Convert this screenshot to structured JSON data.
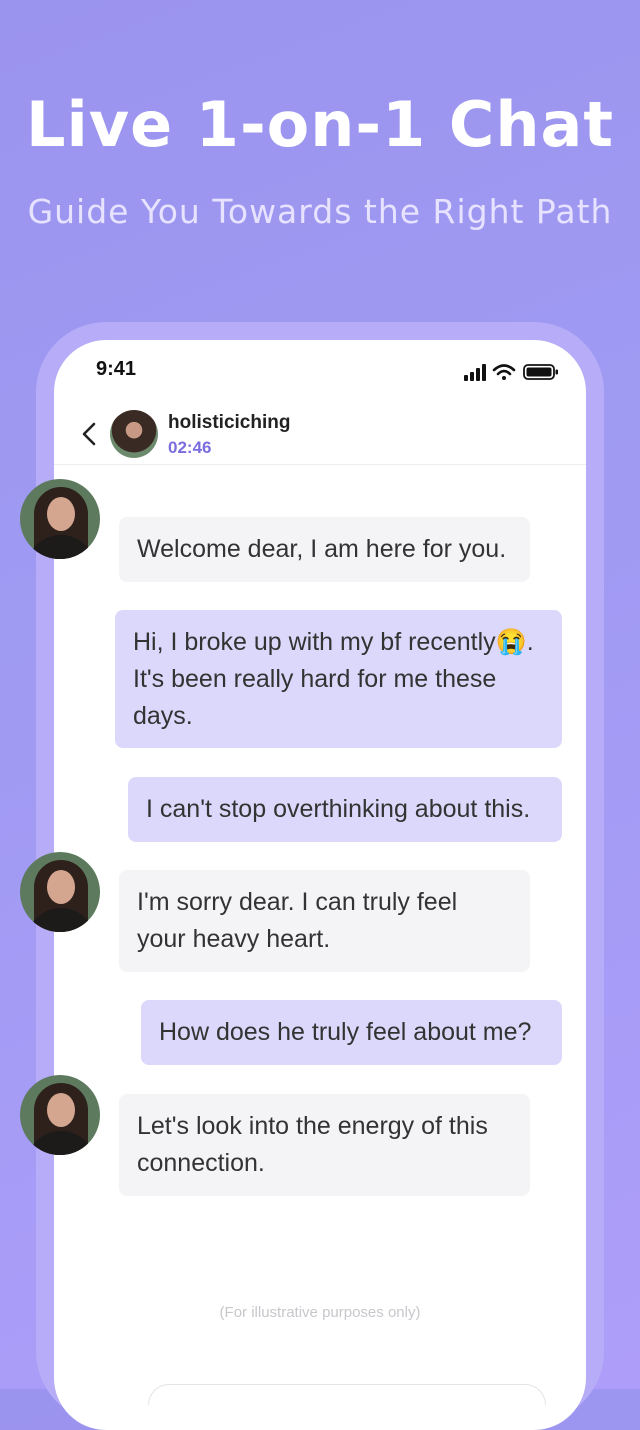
{
  "promo": {
    "headline": "Live 1-on-1 Chat",
    "subhead": "Guide You Towards the Right Path"
  },
  "status_bar": {
    "time": "9:41",
    "icons": [
      "signal-icon",
      "wifi-icon",
      "battery-icon"
    ]
  },
  "chat_header": {
    "back_icon": "chevron-left-icon",
    "name": "holisticiching",
    "timer": "02:46"
  },
  "messages": [
    {
      "sender": "advisor",
      "text": "Welcome dear, I am here for you."
    },
    {
      "sender": "user",
      "text": "Hi, I broke up with my bf recently😭. It's been really hard for me these days."
    },
    {
      "sender": "user",
      "text": "I can't stop overthinking about this."
    },
    {
      "sender": "advisor",
      "text": "I'm sorry dear. I can truly feel your heavy heart."
    },
    {
      "sender": "user",
      "text": "How does he truly feel about me?"
    },
    {
      "sender": "advisor",
      "text": "Let's look into the energy of this connection."
    }
  ],
  "disclaimer": "(For illustrative purposes only)",
  "colors": {
    "background": "#9f9af2",
    "frame": "#b6acf8",
    "user_bubble": "#dcd8fb",
    "advisor_bubble": "#f4f4f7",
    "accent": "#7a6ddf"
  }
}
